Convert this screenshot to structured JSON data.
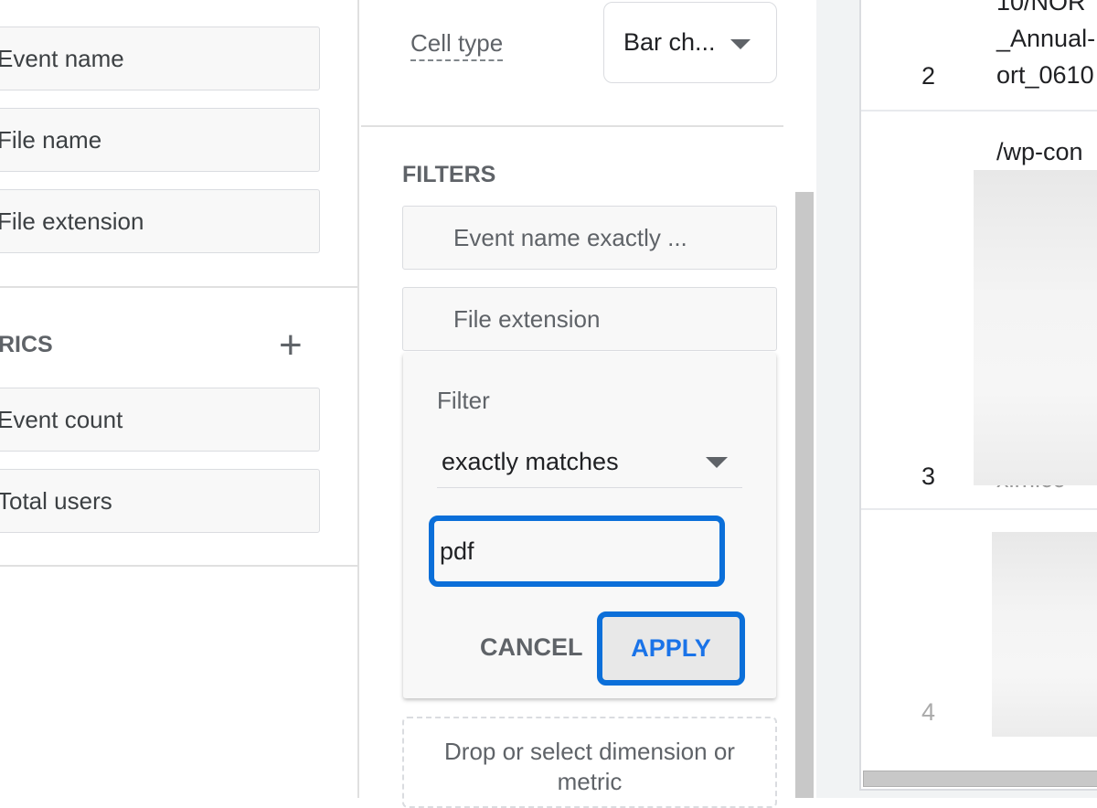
{
  "dimensions": {
    "items": [
      {
        "label": "Event name"
      },
      {
        "label": "File name"
      },
      {
        "label": "File extension"
      }
    ]
  },
  "metrics": {
    "heading": "RICS",
    "add_icon": "plus-icon",
    "items": [
      {
        "label": "Event count"
      },
      {
        "label": "Total users"
      }
    ]
  },
  "settings": {
    "cell_type_label": "Cell type",
    "cell_type_value": "Bar ch...",
    "dropdown_icon": "caret-down-icon"
  },
  "filters": {
    "heading": "FILTERS",
    "items": [
      {
        "label": "Event name exactly ..."
      },
      {
        "label": "File extension"
      }
    ],
    "editor": {
      "label": "Filter",
      "match_type": "exactly matches",
      "value": "pdf",
      "cancel": "CANCEL",
      "apply": "APPLY"
    },
    "drop_zone": "Drop or select dimension or metric"
  },
  "table": {
    "rows": [
      {
        "num": "2",
        "lines": [
          "10/NOR",
          "_Annual-",
          "ort_0610"
        ]
      },
      {
        "num": "3",
        "lines": [
          "/wp-con",
          "xlmlсс"
        ]
      },
      {
        "num": "4",
        "lines": []
      }
    ]
  },
  "colors": {
    "accent": "#1a73e8",
    "focus": "#0b6fd9"
  }
}
